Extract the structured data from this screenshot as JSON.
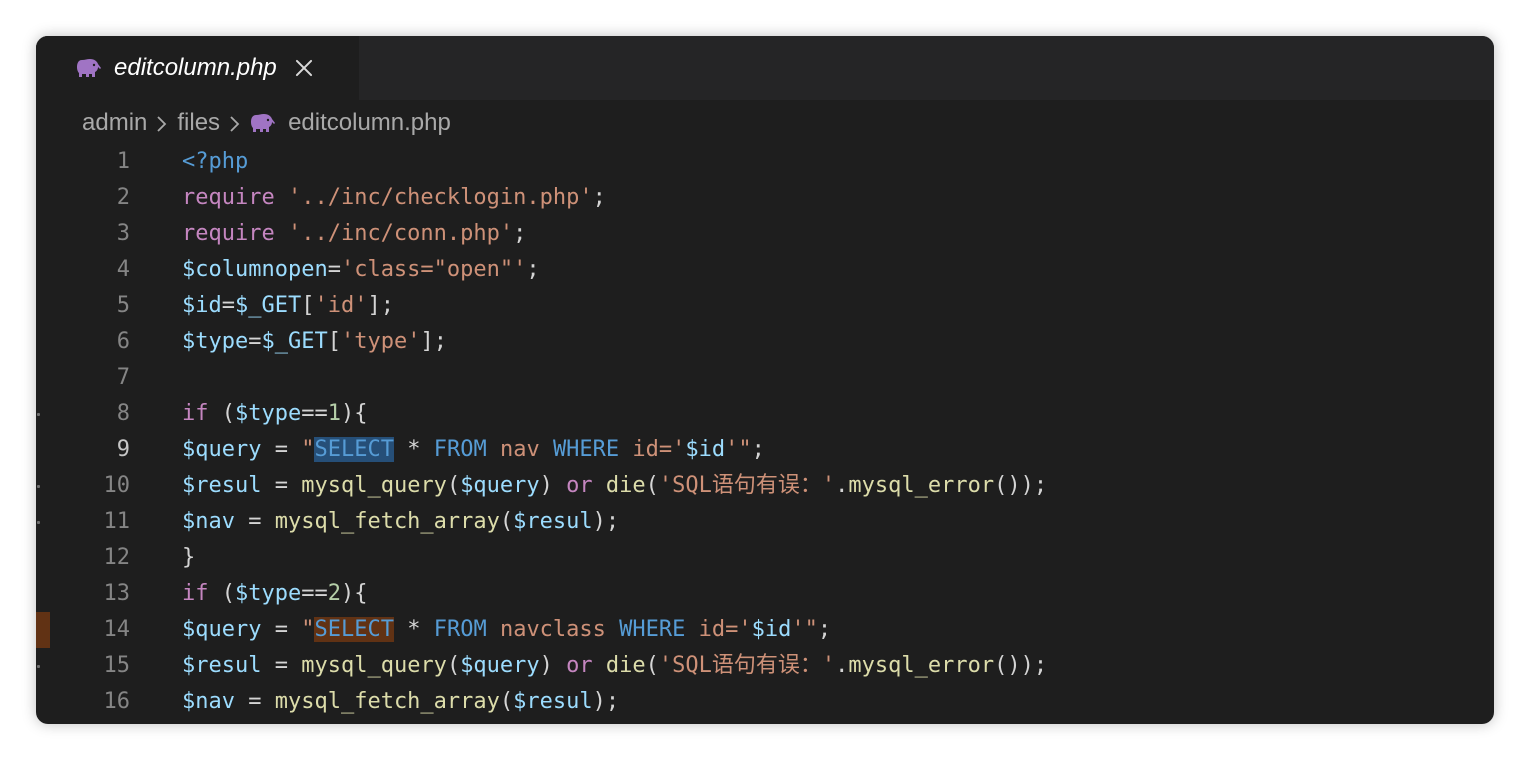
{
  "tab": {
    "title": "editcolumn.php",
    "icon": "php-elephant-icon"
  },
  "breadcrumb": [
    "admin",
    "files",
    "editcolumn.php"
  ],
  "colors": {
    "background": "#1e1e1e",
    "tabbar": "#252526",
    "php_icon": "#a074c4",
    "selection": "#264f78",
    "find_match": "#613214"
  },
  "editor": {
    "line_numbers": [
      "1",
      "2",
      "3",
      "4",
      "5",
      "6",
      "7",
      "8",
      "9",
      "10",
      "11",
      "12",
      "13",
      "14",
      "15",
      "16"
    ],
    "active_line": "9",
    "lines": [
      [
        [
          "kw2",
          "<?php"
        ]
      ],
      [
        [
          "kw",
          "require"
        ],
        [
          "op",
          " "
        ],
        [
          "str",
          "'../inc/checklogin.php'"
        ],
        [
          "op",
          ";"
        ]
      ],
      [
        [
          "kw",
          "require"
        ],
        [
          "op",
          " "
        ],
        [
          "str",
          "'../inc/conn.php'"
        ],
        [
          "op",
          ";"
        ]
      ],
      [
        [
          "var",
          "$columnopen"
        ],
        [
          "op",
          "="
        ],
        [
          "str",
          "'class=\"open\"'"
        ],
        [
          "op",
          ";"
        ]
      ],
      [
        [
          "var",
          "$id"
        ],
        [
          "op",
          "="
        ],
        [
          "var",
          "$_GET"
        ],
        [
          "op",
          "["
        ],
        [
          "str",
          "'id'"
        ],
        [
          "op",
          "];"
        ]
      ],
      [
        [
          "var",
          "$type"
        ],
        [
          "op",
          "="
        ],
        [
          "var",
          "$_GET"
        ],
        [
          "op",
          "["
        ],
        [
          "str",
          "'type'"
        ],
        [
          "op",
          "];"
        ]
      ],
      [],
      [
        [
          "kw",
          "if"
        ],
        [
          "op",
          " ("
        ],
        [
          "var",
          "$type"
        ],
        [
          "op",
          "=="
        ],
        [
          "num",
          "1"
        ],
        [
          "op",
          "){"
        ]
      ],
      [
        [
          "var",
          "$query"
        ],
        [
          "op",
          " = "
        ],
        [
          "str",
          "\""
        ],
        [
          "kw2 hl-sel",
          "SELECT"
        ],
        [
          "op",
          " * "
        ],
        [
          "kw2",
          "FROM"
        ],
        [
          "str",
          " nav "
        ],
        [
          "kw2",
          "WHERE"
        ],
        [
          "str",
          " id='"
        ],
        [
          "var",
          "$id"
        ],
        [
          "str",
          "'\""
        ],
        [
          "op",
          ";"
        ]
      ],
      [
        [
          "var",
          "$resul"
        ],
        [
          "op",
          " = "
        ],
        [
          "fn",
          "mysql_query"
        ],
        [
          "op",
          "("
        ],
        [
          "var",
          "$query"
        ],
        [
          "op",
          ") "
        ],
        [
          "kw",
          "or"
        ],
        [
          "op",
          " "
        ],
        [
          "fn",
          "die"
        ],
        [
          "op",
          "("
        ],
        [
          "str",
          "'SQL语句有误：'"
        ],
        [
          "op",
          "."
        ],
        [
          "fn",
          "mysql_error"
        ],
        [
          "op",
          "());"
        ]
      ],
      [
        [
          "var",
          "$nav"
        ],
        [
          "op",
          " = "
        ],
        [
          "fn",
          "mysql_fetch_array"
        ],
        [
          "op",
          "("
        ],
        [
          "var",
          "$resul"
        ],
        [
          "op",
          ");"
        ]
      ],
      [
        [
          "op",
          "}"
        ]
      ],
      [
        [
          "kw",
          "if"
        ],
        [
          "op",
          " ("
        ],
        [
          "var",
          "$type"
        ],
        [
          "op",
          "=="
        ],
        [
          "num",
          "2"
        ],
        [
          "op",
          "){"
        ]
      ],
      [
        [
          "var",
          "$query"
        ],
        [
          "op",
          " = "
        ],
        [
          "str",
          "\""
        ],
        [
          "kw2 hl-find",
          "SELECT"
        ],
        [
          "op",
          " * "
        ],
        [
          "kw2",
          "FROM"
        ],
        [
          "str",
          " navclass "
        ],
        [
          "kw2",
          "WHERE"
        ],
        [
          "str",
          " id='"
        ],
        [
          "var",
          "$id"
        ],
        [
          "str",
          "'\""
        ],
        [
          "op",
          ";"
        ]
      ],
      [
        [
          "var",
          "$resul"
        ],
        [
          "op",
          " = "
        ],
        [
          "fn",
          "mysql_query"
        ],
        [
          "op",
          "("
        ],
        [
          "var",
          "$query"
        ],
        [
          "op",
          ") "
        ],
        [
          "kw",
          "or"
        ],
        [
          "op",
          " "
        ],
        [
          "fn",
          "die"
        ],
        [
          "op",
          "("
        ],
        [
          "str",
          "'SQL语句有误：'"
        ],
        [
          "op",
          "."
        ],
        [
          "fn",
          "mysql_error"
        ],
        [
          "op",
          "());"
        ]
      ],
      [
        [
          "var",
          "$nav"
        ],
        [
          "op",
          " = "
        ],
        [
          "fn",
          "mysql_fetch_array"
        ],
        [
          "op",
          "("
        ],
        [
          "var",
          "$resul"
        ],
        [
          "op",
          ");"
        ]
      ]
    ]
  }
}
